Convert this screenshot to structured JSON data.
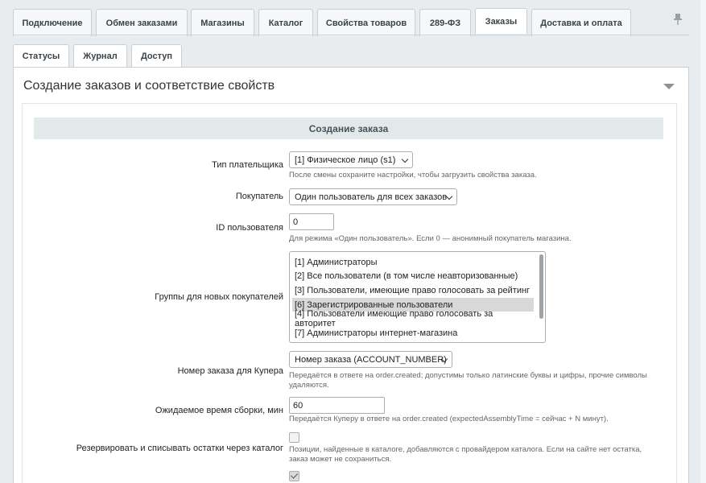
{
  "tabs": [
    "Подключение",
    "Обмен заказами",
    "Магазины",
    "Каталог",
    "Свойства товаров",
    "289-ФЗ",
    "Заказы",
    "Доставка и оплата"
  ],
  "active_tab": "Заказы",
  "subtabs": [
    "Статусы",
    "Журнал",
    "Доступ"
  ],
  "section": {
    "title": "Создание заказов и соответствие свойств"
  },
  "block": {
    "title": "Создание заказа"
  },
  "fields": {
    "payer_type": {
      "label": "Тип плательщика",
      "value": "[1] Физическое лицо (s1)",
      "hint": "После смены сохраните настройки, чтобы загрузить свойства заказа."
    },
    "buyer": {
      "label": "Покупатель",
      "value": "Один пользователь для всех заказов"
    },
    "user_id": {
      "label": "ID пользователя",
      "value": "0",
      "hint": "Для режима «Один пользователь». Если 0 — анонимный покупатель магазина."
    },
    "groups": {
      "label": "Группы для новых покупателей",
      "options": [
        "[1] Администраторы",
        "[2] Все пользователи (в том числе неавторизованные)",
        "[3] Пользователи, имеющие право голосовать за рейтинг",
        "[6] Зарегистрированные пользователи",
        "[4] Пользователи имеющие право голосовать за авторитет",
        "[7] Администраторы интернет-магазина"
      ],
      "selected": "[6] Зарегистрированные пользователи"
    },
    "order_number": {
      "label": "Номер заказа для Купера",
      "value": "Номер заказа (ACCOUNT_NUMBER)",
      "hint_line1": "Передаётся в ответе на order.created; допустимы только латинские буквы и цифры, прочие символы",
      "hint_line2": "удаляются."
    },
    "assembly_time": {
      "label": "Ожидаемое время сборки, мин",
      "value": "60",
      "hint": "Передаётся Куперу в ответе на order.created (expectedAssemblyTime = сейчас + N минут)."
    },
    "reserve": {
      "label": "Резервировать и списывать остатки через каталог",
      "checked": false,
      "hint_line1": "Позиции, найденные в каталоге, добавляются с провайдером каталога. Если на сайте нет остатка,",
      "hint_line2": "заказ может не сохраниться."
    },
    "extra_checkbox": {
      "checked": true
    }
  },
  "icons": {
    "pin": "pin-icon",
    "collapse": "collapse-arrow-icon"
  }
}
